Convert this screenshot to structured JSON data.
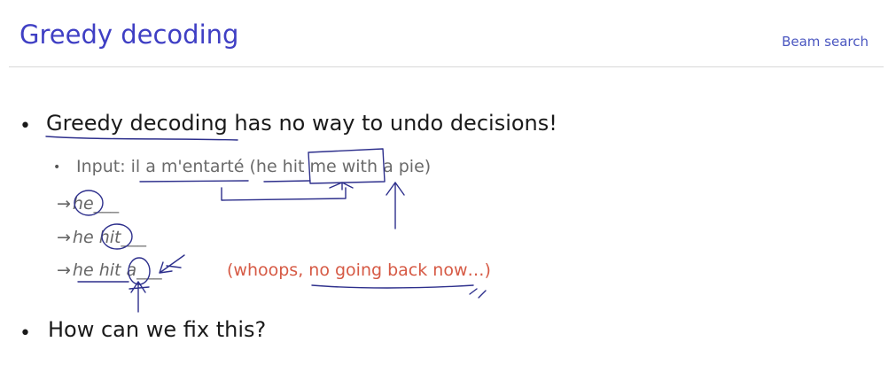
{
  "slide": {
    "title": "Greedy decoding",
    "section": "Beam search"
  },
  "bullets": {
    "first": "Greedy decoding has no way to undo decisions!",
    "second": "How can we fix this?"
  },
  "input_line": {
    "prefix": "Input: ",
    "source": "il a m'entarté",
    "translation": "(he hit me with a pie)"
  },
  "steps": [
    {
      "arrow": "→",
      "words": "he",
      "blank": "___"
    },
    {
      "arrow": "→",
      "words": "he hit",
      "blank": "___"
    },
    {
      "arrow": "→",
      "words": "he hit a",
      "blank": "___"
    }
  ],
  "note": "(whoops, no going back now…)",
  "colors": {
    "title": "#3f3fc4",
    "ink": "#2d2f8c",
    "note": "#d65a45"
  }
}
